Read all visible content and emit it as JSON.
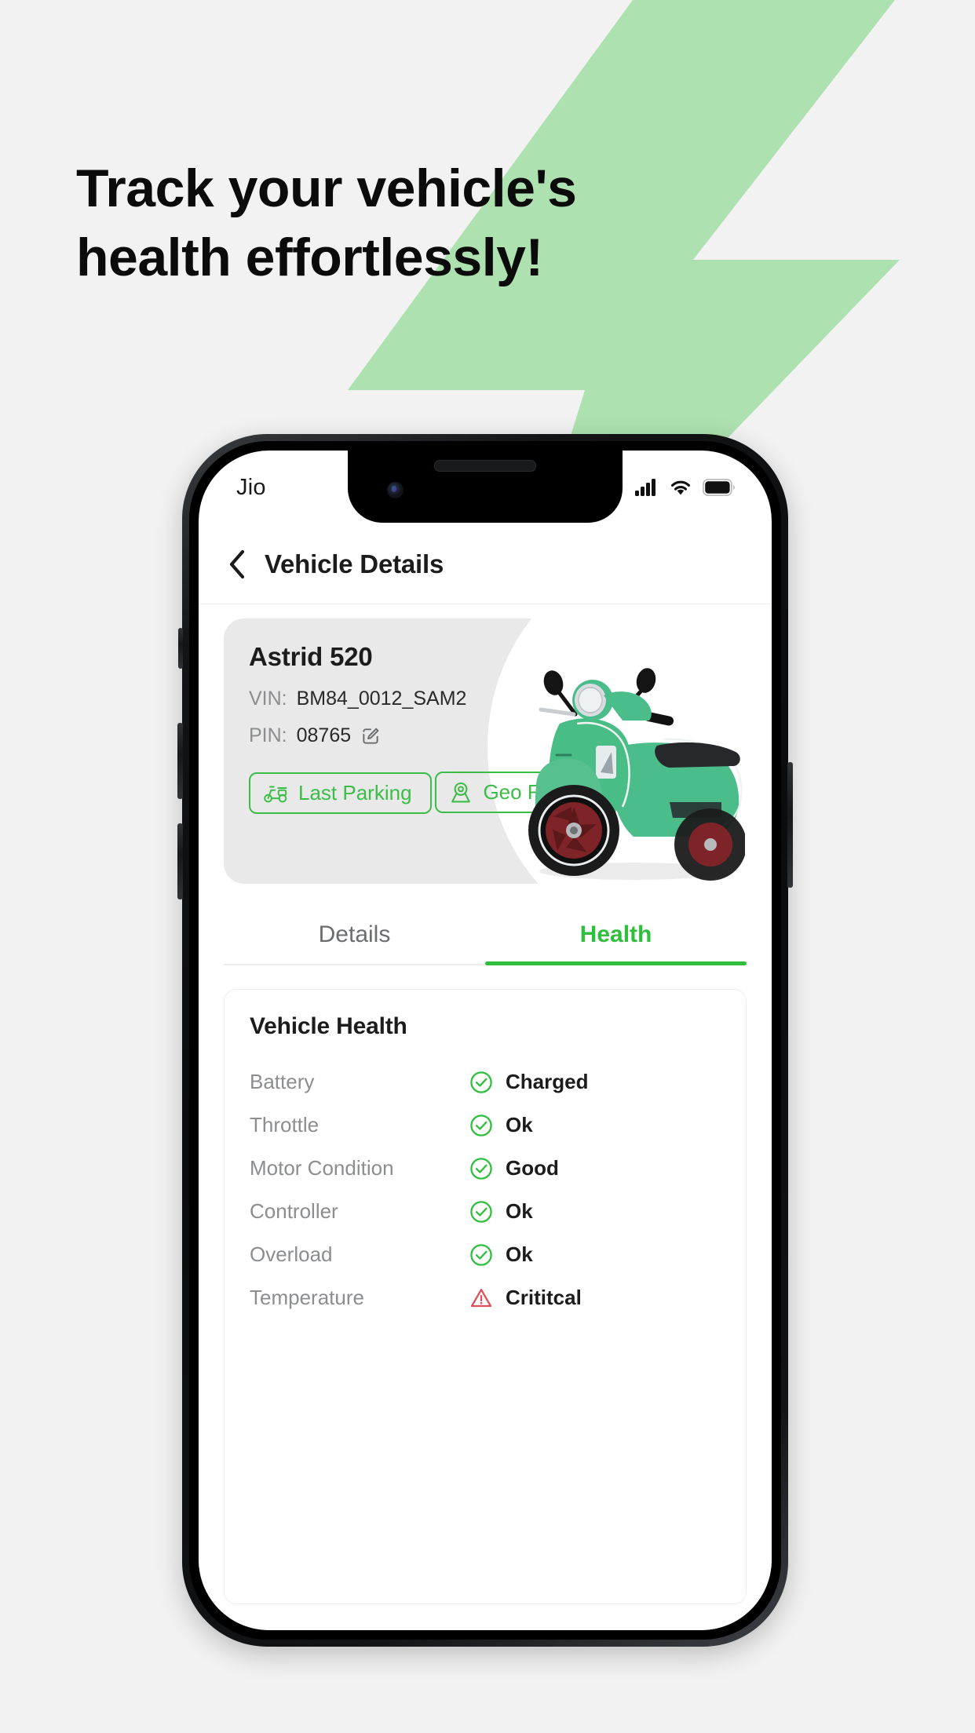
{
  "promo": {
    "headline_line1": "Track your vehicle's",
    "headline_line2": "health effortlessly!",
    "background_color": "#f2f2f2",
    "bolt_color": "#ade2b0"
  },
  "status_bar": {
    "carrier": "Jio",
    "signal_icon": "cellular-bars-icon",
    "wifi_icon": "wifi-icon",
    "battery_icon": "battery-full-icon"
  },
  "nav": {
    "back_icon": "chevron-left-icon",
    "title": "Vehicle Details"
  },
  "vehicle": {
    "name": "Astrid 520",
    "vin_label": "VIN:",
    "vin_value": "BM84_0012_SAM2",
    "pin_label": "PIN:",
    "pin_value": "08765",
    "edit_icon": "edit-pencil-icon",
    "image_icon": "scooter-image",
    "actions": [
      {
        "label": "Last Parking",
        "icon": "scooter-icon"
      },
      {
        "label": "Geo Fencing",
        "icon": "geo-fence-pin-icon"
      }
    ],
    "accent_color": "#3bbd47"
  },
  "tabs": [
    {
      "label": "Details",
      "active": false
    },
    {
      "label": "Health",
      "active": true
    }
  ],
  "health": {
    "title": "Vehicle Health",
    "ok_color": "#2fbf3d",
    "critical_color": "#e0505a",
    "rows": [
      {
        "label": "Battery",
        "status": "Charged",
        "icon": "check-circle-icon",
        "state": "ok"
      },
      {
        "label": "Throttle",
        "status": "Ok",
        "icon": "check-circle-icon",
        "state": "ok"
      },
      {
        "label": "Motor Condition",
        "status": "Good",
        "icon": "check-circle-icon",
        "state": "ok"
      },
      {
        "label": "Controller",
        "status": "Ok",
        "icon": "check-circle-icon",
        "state": "ok"
      },
      {
        "label": "Overload",
        "status": "Ok",
        "icon": "check-circle-icon",
        "state": "ok"
      },
      {
        "label": "Temperature",
        "status": "Crititcal",
        "icon": "warning-triangle-icon",
        "state": "critical"
      }
    ]
  }
}
